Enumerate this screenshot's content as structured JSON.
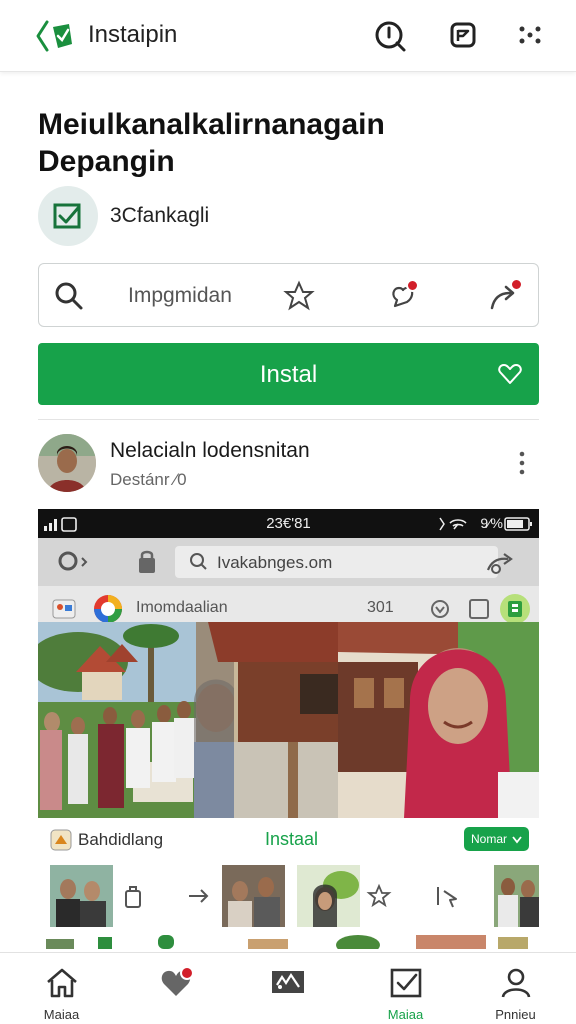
{
  "header": {
    "title": "Instaipin",
    "icons": [
      "back-arrow-logo-icon",
      "info-icon",
      "flag-icon",
      "more-icon"
    ]
  },
  "app": {
    "title": "Meiulkanalkalirnanagain Depangin",
    "publisher": "3Cfankagli"
  },
  "search": {
    "placeholder": "Impgmidan",
    "icons": [
      "search-icon",
      "star-icon",
      "heart-notify-icon",
      "share-icon"
    ]
  },
  "install": {
    "label": "Instal",
    "icon": "heart-outline-icon"
  },
  "post": {
    "author": "Nelacialn lodensnitan",
    "subtitle": "Destánr ⁄0"
  },
  "screenshot": {
    "time": "23€'81",
    "battery": "9⁄%",
    "url": "Ivakabnges.om",
    "tab_text": "Imomdaalian",
    "tab_count": "301",
    "bar_name": "Bahdidlang",
    "bar_install": "Instaal",
    "bar_pill": "Nomar"
  },
  "colors": {
    "accent": "#17a24a",
    "notification": "#d21f2a"
  },
  "nav": {
    "items": [
      {
        "label": "Maiaa",
        "icon": "home-icon",
        "active": false
      },
      {
        "label": "",
        "icon": "heart-icon",
        "active": false
      },
      {
        "label": "",
        "icon": "media-icon",
        "active": false
      },
      {
        "label": "Maiaa",
        "icon": "checkbox-icon",
        "active": true
      },
      {
        "label": "Pnnieu",
        "icon": "profile-icon",
        "active": false
      }
    ]
  }
}
